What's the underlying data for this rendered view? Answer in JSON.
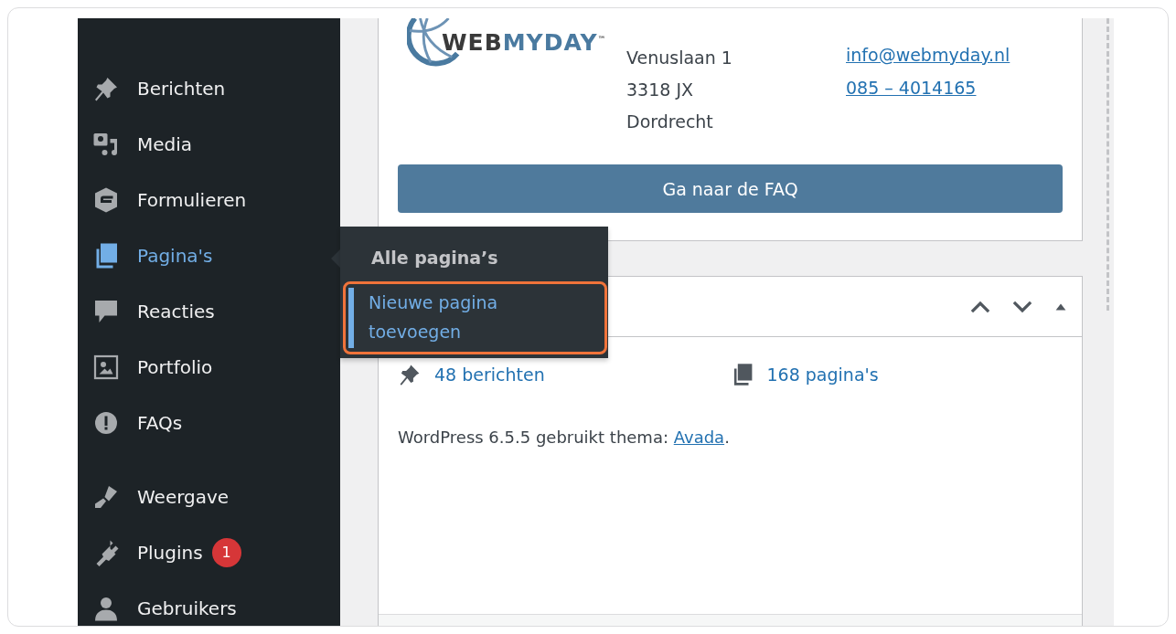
{
  "sidebar": {
    "groups": [
      [
        {
          "label": "Berichten",
          "selected": false
        },
        {
          "label": "Media",
          "selected": false
        },
        {
          "label": "Formulieren",
          "selected": false
        },
        {
          "label": "Pagina's",
          "selected": true
        },
        {
          "label": "Reacties",
          "selected": false
        },
        {
          "label": "Portfolio",
          "selected": false
        },
        {
          "label": "FAQs",
          "selected": false
        }
      ],
      [
        {
          "label": "Weergave",
          "selected": false
        },
        {
          "label": "Plugins",
          "selected": false,
          "badge": "1"
        },
        {
          "label": "Gebruikers",
          "selected": false
        }
      ]
    ]
  },
  "flyout": {
    "items": [
      {
        "label": "Alle pagina’s",
        "selected": false
      },
      {
        "label": "Nieuwe pagina toevoegen",
        "selected": true,
        "highlighted": true
      }
    ]
  },
  "contact_card": {
    "logo": {
      "text_dark": "WEB",
      "text_blue": "MYDAY",
      "mark": "™"
    },
    "address": [
      "Venuslaan 1",
      "3318 JX",
      "Dordrecht"
    ],
    "links": [
      "info@webmyday.nl",
      "085 – 4014165"
    ],
    "button": "Ga naar de FAQ"
  },
  "overview_card": {
    "counts": [
      "48 berichten",
      "168 pagina's"
    ],
    "version_text": "WordPress 6.5.5 gebruikt thema: ",
    "theme_link": "Avada",
    "version_end": "."
  }
}
